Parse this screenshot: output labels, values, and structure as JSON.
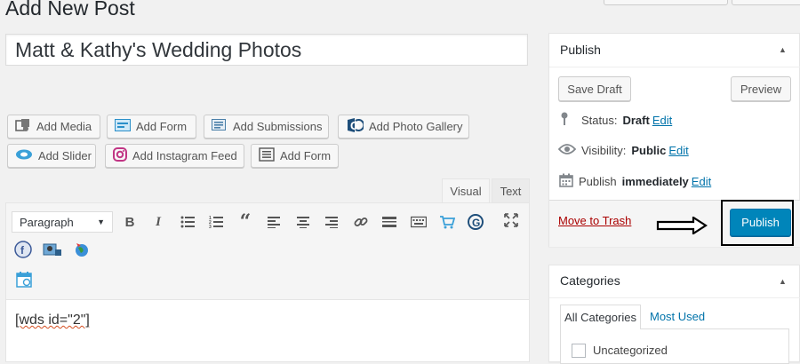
{
  "page_title": "Add New Post",
  "post_title": "Matt & Kathy's Wedding Photos",
  "media_buttons": {
    "row1": [
      {
        "label": "Add Media",
        "icon": "media-icon"
      },
      {
        "label": "Add Form",
        "icon": "form-icon"
      },
      {
        "label": "Add Submissions",
        "icon": "submissions-icon"
      },
      {
        "label": "Add Photo Gallery",
        "icon": "photo-gallery-icon"
      }
    ],
    "row2": [
      {
        "label": "Add Slider",
        "icon": "slider-icon"
      },
      {
        "label": "Add Instagram Feed",
        "icon": "instagram-icon"
      },
      {
        "label": "Add Form",
        "icon": "form-list-icon"
      }
    ]
  },
  "editor": {
    "tabs": {
      "visual": "Visual",
      "text": "Text"
    },
    "format_select": "Paragraph",
    "content": "[wds id=\"2\"]"
  },
  "publish_box": {
    "title": "Publish",
    "save_draft": "Save Draft",
    "preview": "Preview",
    "status_label": "Status:",
    "status_value": "Draft",
    "visibility_label": "Visibility:",
    "visibility_value": "Public",
    "publish_label": "Publish",
    "publish_value": "immediately",
    "edit": "Edit",
    "move_to_trash": "Move to Trash",
    "publish_button": "Publish"
  },
  "categories_box": {
    "title": "Categories",
    "tab_all": "All Categories",
    "tab_used": "Most Used",
    "first_item": "Uncategorized"
  },
  "colors": {
    "primary": "#0085ba",
    "link": "#0073aa",
    "trash": "#a00000",
    "background": "#f1f1f1"
  }
}
